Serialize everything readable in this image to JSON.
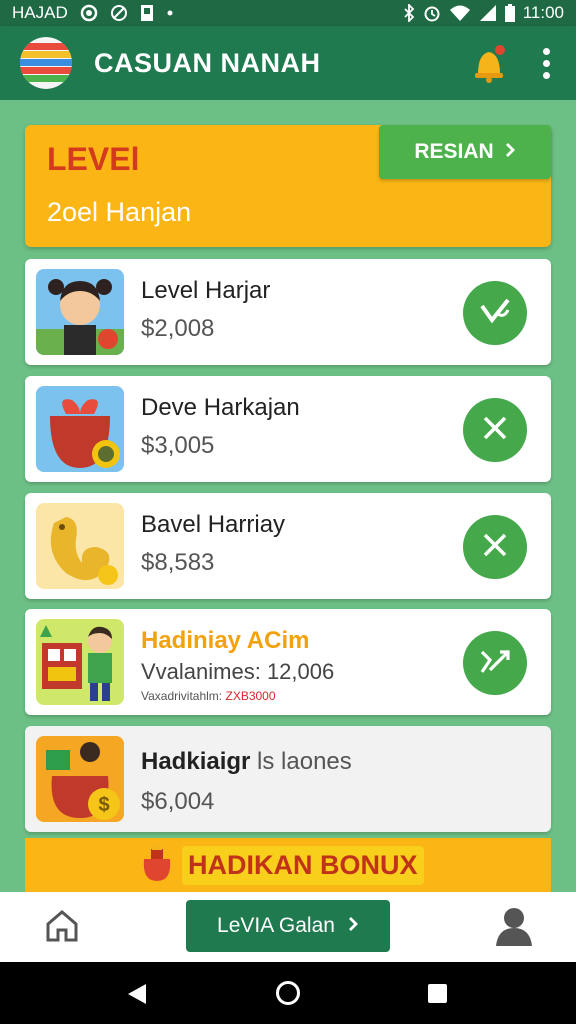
{
  "status_bar": {
    "carrier": "HAJAD",
    "time": "11:00",
    "icons": [
      "camera-icon",
      "no-sound-icon",
      "sim-icon",
      "dot-icon",
      "bluetooth-icon",
      "alarm-icon",
      "wifi-icon",
      "signal-icon",
      "battery-icon"
    ]
  },
  "app_bar": {
    "title": "CASUAN NANAH",
    "logo_icon": "ball-logo-icon",
    "bell_icon": "bell-icon",
    "menu_icon": "more-vert-icon"
  },
  "level_card": {
    "title": "LEVEl",
    "subtitle": "2oel Hanjan",
    "button_label": "RESIAN"
  },
  "items": [
    {
      "name": "Level Harjar",
      "price": "$2,008",
      "thumb": "boy-avatar-icon",
      "action": "check-icon"
    },
    {
      "name": "Deve Harkajan",
      "price": "$3,005",
      "thumb": "gift-bag-icon",
      "action": "close-icon"
    },
    {
      "name": "Bavel Harriay",
      "price": "$8,583",
      "thumb": "gold-coin-icon",
      "action": "close-icon"
    },
    {
      "name": "Hadiniay ACim",
      "sub1": "Vvalanimes: 12,006",
      "sub2_label": "Vaxadrivitahlm:",
      "sub2_value": "ZXB3000",
      "thumb": "boy-board-icon",
      "action": "shuffle-icon"
    },
    {
      "name": "Hadkiaigr",
      "name_suffix": "ls laones",
      "price": "$6,004",
      "thumb": "money-bag-icon"
    }
  ],
  "bonus": {
    "label": "HADIKAN BONUX",
    "icon": "bag-icon"
  },
  "bottom_nav": {
    "home_icon": "home-icon",
    "primary_label": "LeVIA Galan",
    "profile_icon": "person-icon"
  },
  "colors": {
    "app_bar": "#1f7a50",
    "background": "#6cbf85",
    "accent_orange": "#fbb615",
    "action_green": "#45a84a",
    "level_red": "#d43b1c"
  }
}
